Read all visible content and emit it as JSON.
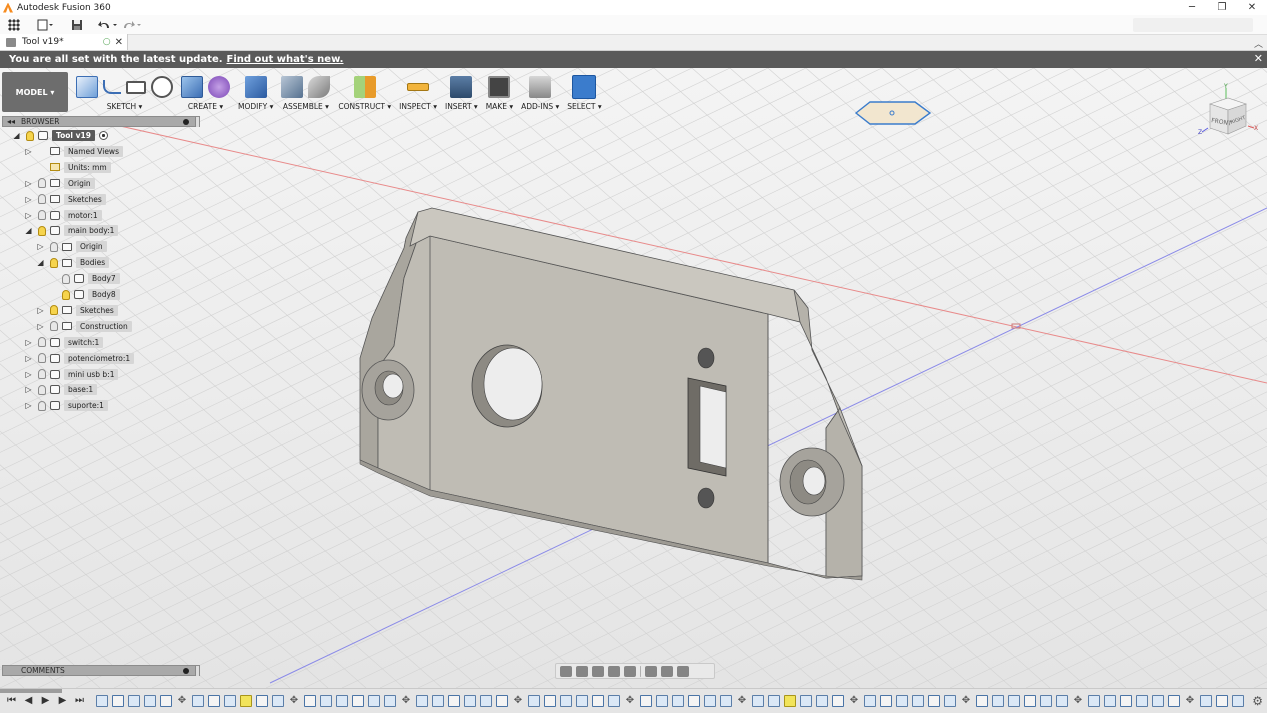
{
  "window": {
    "title": "Autodesk Fusion 360",
    "controls": [
      "─",
      "❐",
      "✕"
    ]
  },
  "quick_access": {
    "icons": [
      "grid-icon",
      "file-icon",
      "save-icon",
      "undo-icon",
      "redo-icon"
    ]
  },
  "document_tab": {
    "title": "Tool v19*"
  },
  "notification": {
    "message": "You are all set with the latest update.",
    "link": "Find out what's new."
  },
  "ribbon": {
    "workspace": "MODEL ▾",
    "groups": [
      {
        "label": "SKETCH ▾",
        "icons": [
          "sketch",
          "line",
          "rect",
          "circle"
        ]
      },
      {
        "label": "CREATE ▾",
        "icons": [
          "box",
          "form"
        ]
      },
      {
        "label": "MODIFY ▾",
        "icons": [
          "press"
        ]
      },
      {
        "label": "ASSEMBLE ▾",
        "icons": [
          "assemble",
          "joint"
        ]
      },
      {
        "label": "CONSTRUCT ▾",
        "icons": [
          "construct"
        ]
      },
      {
        "label": "INSPECT ▾",
        "icons": [
          "inspect"
        ]
      },
      {
        "label": "INSERT ▾",
        "icons": [
          "insert"
        ]
      },
      {
        "label": "MAKE ▾",
        "icons": [
          "make"
        ]
      },
      {
        "label": "ADD-INS ▾",
        "icons": [
          "addins"
        ]
      },
      {
        "label": "SELECT ▾",
        "icons": [
          "select"
        ]
      }
    ]
  },
  "viewcube": {
    "front": "FRONT",
    "right": "RIGHT",
    "axis_y": "Y",
    "axis_x": "X",
    "axis_z": "Z"
  },
  "browser": {
    "title": "BROWSER",
    "tree": [
      {
        "label": "Tool v19",
        "depth": 0,
        "expander": "open",
        "kind": "root",
        "bulb": "on"
      },
      {
        "label": "Named Views",
        "depth": 1,
        "expander": "closed",
        "kind": "folder",
        "bulb": "none"
      },
      {
        "label": "Units: mm",
        "depth": 1,
        "expander": "none",
        "kind": "units",
        "bulb": "none"
      },
      {
        "label": "Origin",
        "depth": 1,
        "expander": "closed",
        "kind": "folder",
        "bulb": "off"
      },
      {
        "label": "Sketches",
        "depth": 1,
        "expander": "closed",
        "kind": "folder",
        "bulb": "off"
      },
      {
        "label": "motor:1",
        "depth": 1,
        "expander": "closed",
        "kind": "comp",
        "bulb": "off"
      },
      {
        "label": "main body:1",
        "depth": 1,
        "expander": "open",
        "kind": "comp",
        "bulb": "on"
      },
      {
        "label": "Origin",
        "depth": 2,
        "expander": "closed",
        "kind": "folder",
        "bulb": "off"
      },
      {
        "label": "Bodies",
        "depth": 2,
        "expander": "open",
        "kind": "folder",
        "bulb": "on"
      },
      {
        "label": "Body7",
        "depth": 3,
        "expander": "none",
        "kind": "comp",
        "bulb": "off"
      },
      {
        "label": "Body8",
        "depth": 3,
        "expander": "none",
        "kind": "comp",
        "bulb": "on"
      },
      {
        "label": "Sketches",
        "depth": 2,
        "expander": "closed",
        "kind": "folder",
        "bulb": "on"
      },
      {
        "label": "Construction",
        "depth": 2,
        "expander": "closed",
        "kind": "folder",
        "bulb": "off"
      },
      {
        "label": "switch:1",
        "depth": 1,
        "expander": "closed",
        "kind": "comp",
        "bulb": "off"
      },
      {
        "label": "potenciometro:1",
        "depth": 1,
        "expander": "closed",
        "kind": "comp",
        "bulb": "off"
      },
      {
        "label": "mini usb b:1",
        "depth": 1,
        "expander": "closed",
        "kind": "comp",
        "bulb": "off"
      },
      {
        "label": "base:1",
        "depth": 1,
        "expander": "closed",
        "kind": "comp",
        "bulb": "off"
      },
      {
        "label": "suporte:1",
        "depth": 1,
        "expander": "closed",
        "kind": "comp",
        "bulb": "off"
      }
    ]
  },
  "comments": {
    "title": "COMMENTS"
  },
  "colors": {
    "part_face": "#bfbcb4",
    "part_top": "#c9c6be",
    "part_shade": "#a9a69e",
    "axis_red": "#e88a8a",
    "axis_blue": "#8a8ae8",
    "select_blue": "#3b7ccc"
  },
  "timeline": {
    "controls": [
      "⏮",
      "◀",
      "▶",
      "▶",
      "⏭"
    ],
    "item_count": 72,
    "highlighted_index": [
      9,
      43
    ]
  }
}
